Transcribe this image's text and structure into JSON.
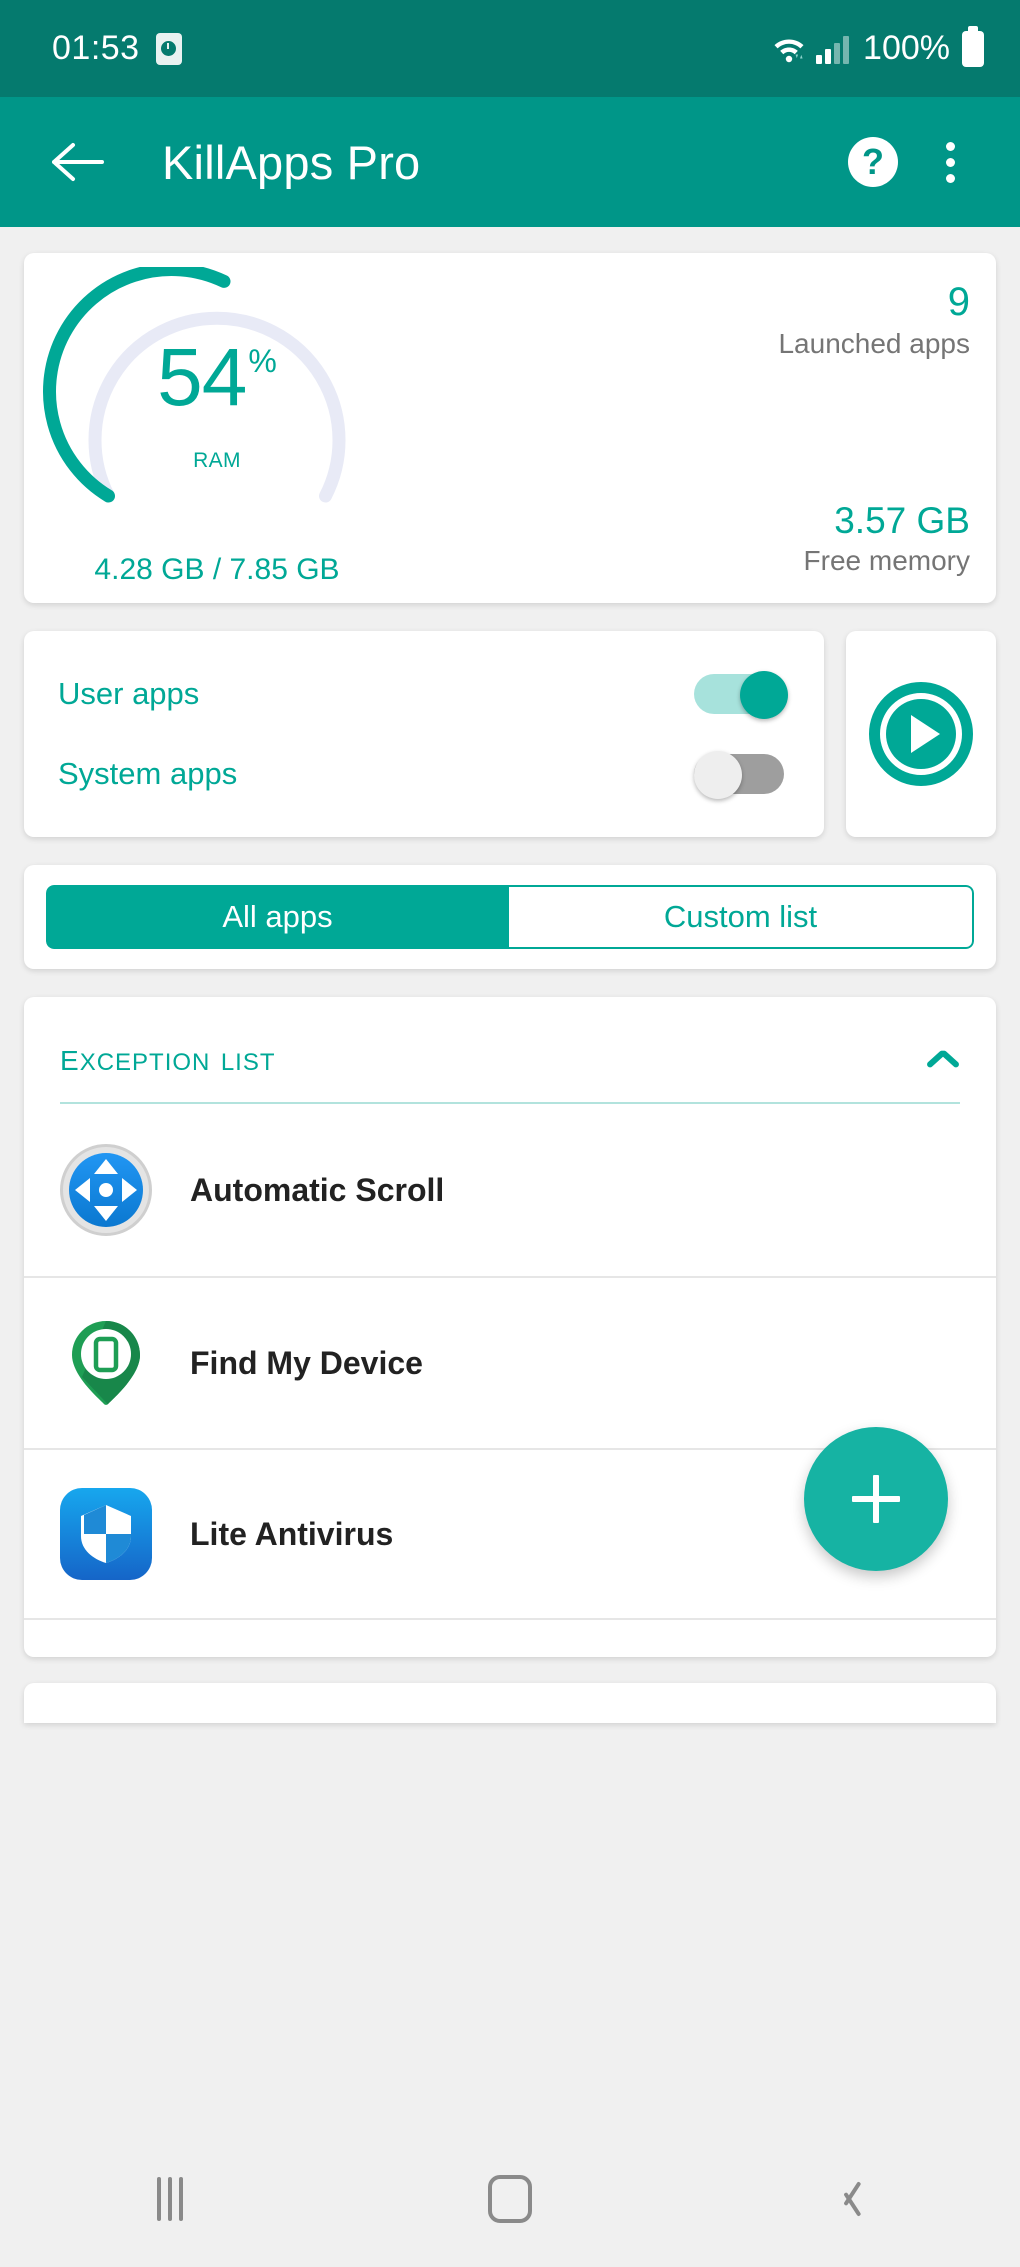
{
  "status_bar": {
    "time": "01:53",
    "alarm_icon": "alarm-clock-icon",
    "wifi_icon": "wifi-icon",
    "signal_icon": "cellular-signal-icon",
    "battery_percent": "100%",
    "battery_icon": "battery-full-icon"
  },
  "app_bar": {
    "back_icon": "back-arrow-icon",
    "title": "KillApps Pro",
    "help_icon": "help-circle-icon",
    "help_glyph": "?",
    "overflow_icon": "overflow-menu-icon"
  },
  "memory": {
    "percent_value": "54",
    "percent_symbol": "%",
    "gauge_label": "RAM",
    "gauge_fraction": 0.54,
    "usage_detail": "4.28 GB / 7.85 GB",
    "launched_apps_count": "9",
    "launched_apps_label": "Launched apps",
    "free_memory_value": "3.57 GB",
    "free_memory_label": "Free memory",
    "accent_color": "#00a896",
    "track_color": "#e8eaf6"
  },
  "filters": {
    "user_apps_label": "User apps",
    "user_apps_on": true,
    "system_apps_label": "System apps",
    "system_apps_on": false,
    "play_icon": "play-circle-icon"
  },
  "tabs": {
    "all_apps_label": "All apps",
    "custom_list_label": "Custom list",
    "active": "All apps"
  },
  "exception_list": {
    "title": "Exception list",
    "collapse_icon": "chevron-up-icon",
    "items": [
      {
        "name": "Automatic Scroll",
        "icon": "automatic-scroll-icon"
      },
      {
        "name": "Find My Device",
        "icon": "find-my-device-icon"
      },
      {
        "name": "Lite Antivirus",
        "icon": "lite-antivirus-icon"
      }
    ],
    "add_button_icon": "plus-icon"
  },
  "nav_bar": {
    "recents_icon": "recents-icon",
    "home_icon": "home-icon",
    "back_icon": "back-icon"
  }
}
